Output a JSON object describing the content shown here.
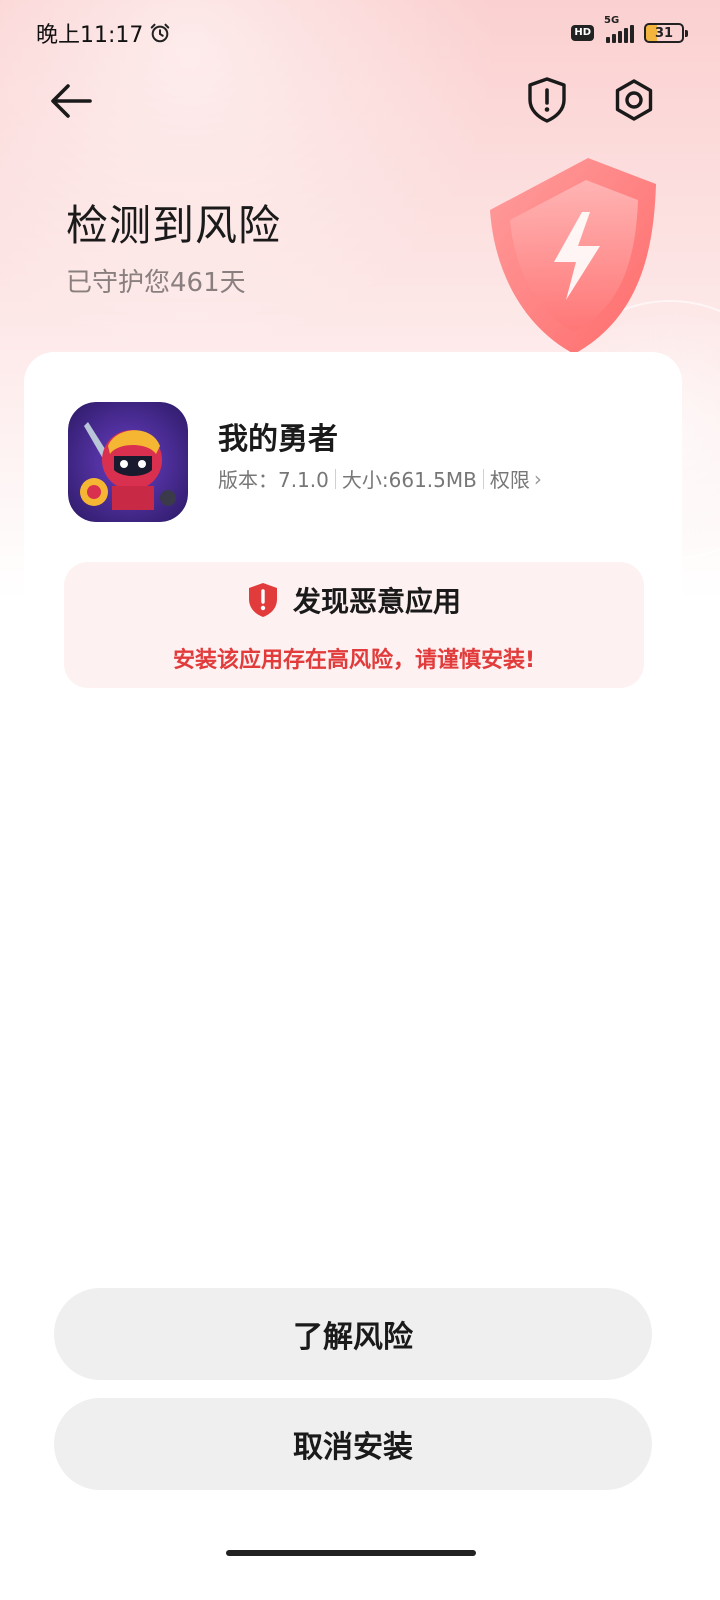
{
  "status_bar": {
    "time": "晚上11:17",
    "hd_label": "HD",
    "network_label": "5G",
    "battery_level": "31"
  },
  "header": {
    "title": "检测到风险",
    "subtitle": "已守护您461天"
  },
  "app": {
    "name": "我的勇者",
    "version": "版本：7.1.0",
    "size": "大小:661.5MB",
    "permissions_label": "权限",
    "permissions_chevron": "›"
  },
  "warning": {
    "title": "发现恶意应用",
    "message": "安装该应用存在高风险，请谨慎安装!"
  },
  "actions": {
    "learn_risk": "了解风险",
    "cancel_install": "取消安装"
  },
  "colors": {
    "danger": "#e23b3b",
    "warning_bg": "#fdf1f1",
    "hero_gradient_top": "#fbd0d0",
    "button_bg": "#efefef"
  },
  "icons": {
    "back": "arrow-left-icon",
    "security_shield": "shield-exclamation-icon",
    "settings": "gear-icon",
    "alarm": "alarm-clock-icon",
    "warning": "shield-exclamation-icon",
    "hero": "shield-lightning-icon"
  }
}
